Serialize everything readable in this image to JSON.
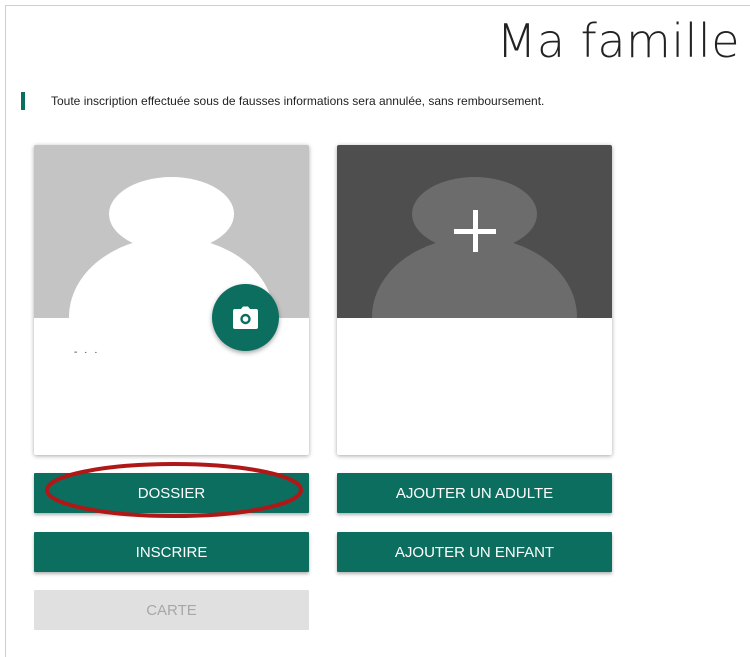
{
  "page": {
    "title": "Ma famille",
    "notice": "Toute inscription effectuée sous de fausses informations sera annulée, sans remboursement."
  },
  "cards": [
    {
      "caption": "- ·  ·",
      "photo_icon": "camera-icon"
    },
    {
      "icon": "plus-icon"
    }
  ],
  "buttons": {
    "dossier": "DOSSIER",
    "inscrire": "INSCRIRE",
    "carte": "CARTE",
    "ajouter_adulte": "AJOUTER UN ADULTE",
    "ajouter_enfant": "AJOUTER UN ENFANT"
  },
  "colors": {
    "primary": "#0c6e5f",
    "disabled": "#e0e0e0",
    "annotation": "#b01818"
  }
}
